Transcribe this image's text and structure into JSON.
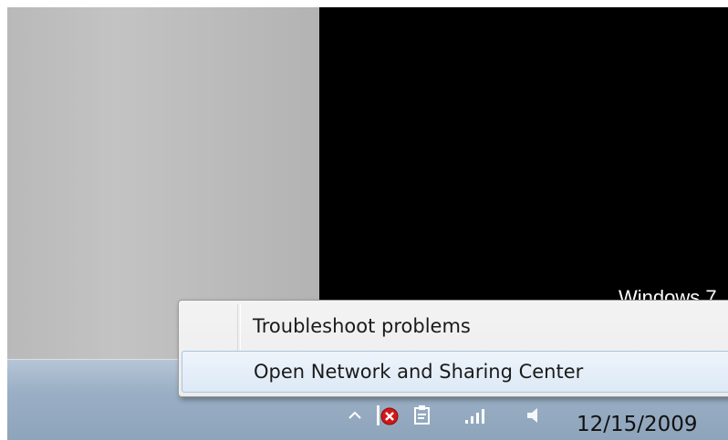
{
  "desktop": {
    "watermark_text": "Windows 7"
  },
  "context_menu": {
    "items": [
      {
        "label": "Troubleshoot problems",
        "highlighted": false
      },
      {
        "label": "Open Network and Sharing Center",
        "highlighted": true
      }
    ]
  },
  "taskbar": {
    "tray_icons": [
      "show-hidden-icons-arrow",
      "security-alert-icon",
      "clipboard-icon",
      "network-signal-icon",
      "volume-icon"
    ],
    "clock": {
      "date": "12/15/2009"
    }
  },
  "colors": {
    "taskbar": "#9aafc5",
    "menu_background": "#f0f0f0",
    "menu_highlight": "#dde9f6",
    "security_alert": "#d01818"
  }
}
